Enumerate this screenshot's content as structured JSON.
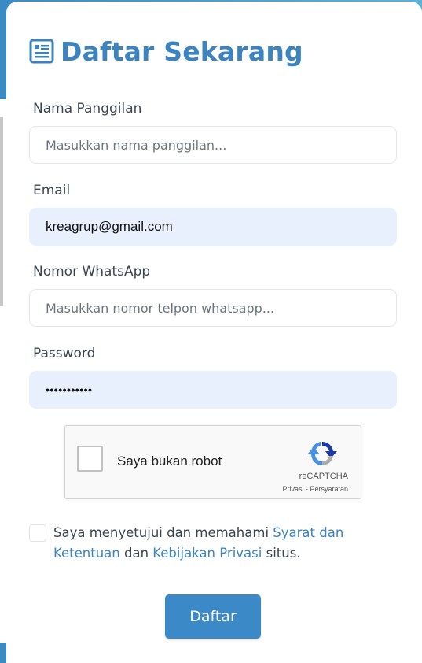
{
  "form": {
    "title": "Daftar Sekarang",
    "title_icon": "newspaper-form-icon",
    "fields": {
      "nickname": {
        "label": "Nama Panggilan",
        "placeholder": "Masukkan nama panggilan...",
        "value": ""
      },
      "email": {
        "label": "Email",
        "placeholder": "",
        "value": "kreagrup@gmail.com"
      },
      "whatsapp": {
        "label": "Nomor WhatsApp",
        "placeholder": "Masukkan nomor telpon whatsapp...",
        "value": ""
      },
      "password": {
        "label": "Password",
        "masked_value": "•••••••••••"
      }
    },
    "captcha": {
      "label": "Saya bukan robot",
      "brand": "reCAPTCHA",
      "privacy": "Privasi",
      "separator": " - ",
      "terms": "Persyaratan",
      "checked": false
    },
    "agreement": {
      "prefix": "Saya menyetujui dan memahami ",
      "terms_link": "Syarat dan Ketentuan",
      "middle": " dan ",
      "privacy_link": "Kebijakan Privasi",
      "suffix": " situs.",
      "checked": false
    },
    "submit_label": "Daftar"
  },
  "colors": {
    "accent": "#3b84c0",
    "button": "#3b89c6",
    "autofill": "#e8f0fe",
    "label": "#3c4653"
  }
}
